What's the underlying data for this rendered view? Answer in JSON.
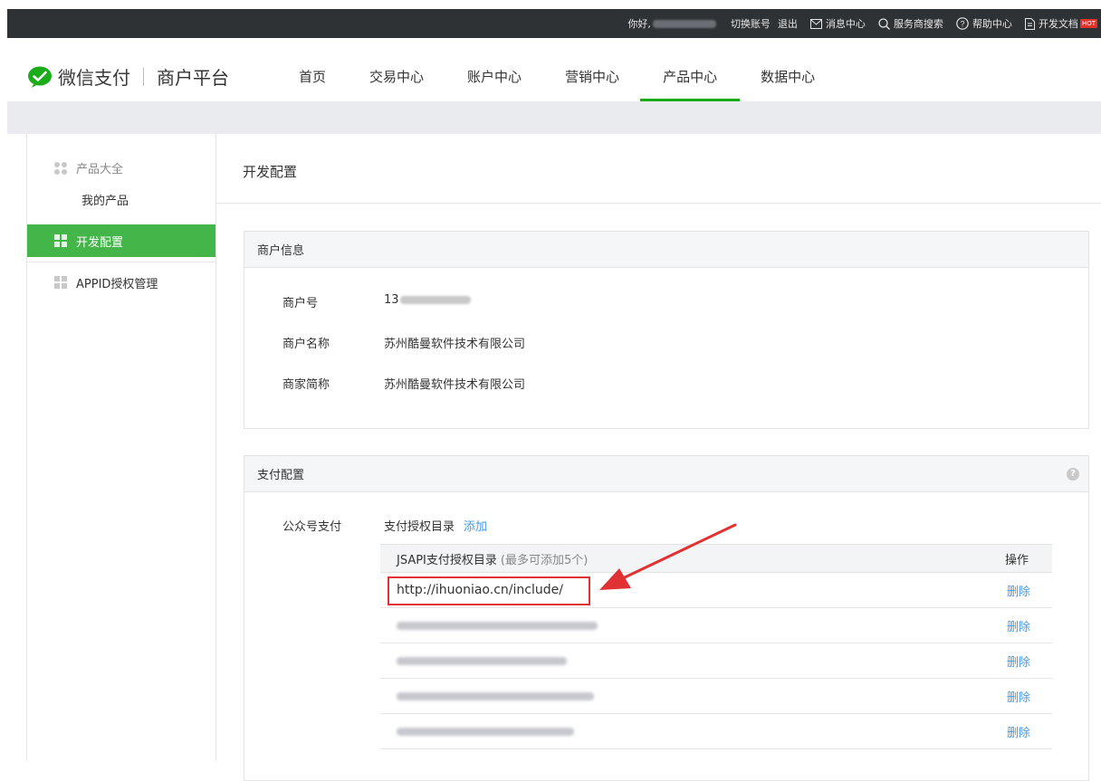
{
  "topbar": {
    "greeting": "你好,",
    "switch_account": "切换账号",
    "logout": "退出",
    "message_center": "消息中心",
    "provider_search": "服务商搜索",
    "help_center": "帮助中心",
    "dev_docs": "开发文档",
    "hot_badge": "HOT"
  },
  "header": {
    "brand": "微信支付",
    "platform": "商户平台",
    "menu": [
      "首页",
      "交易中心",
      "账户中心",
      "营销中心",
      "产品中心",
      "数据中心"
    ],
    "active_index": 4,
    "accent_color": "#1aad19"
  },
  "sidebar": {
    "group_label": "产品大全",
    "sub_item": "我的产品",
    "items": [
      {
        "label": "开发配置",
        "active": true
      },
      {
        "label": "APPID授权管理",
        "active": false
      }
    ]
  },
  "main": {
    "title": "开发配置",
    "merchant_panel": {
      "title": "商户信息",
      "rows": [
        {
          "label": "商户号",
          "value": "13"
        },
        {
          "label": "商户名称",
          "value": "苏州酷曼软件技术有限公司"
        },
        {
          "label": "商家简称",
          "value": "苏州酷曼软件技术有限公司"
        }
      ]
    },
    "payment_panel": {
      "title": "支付配置",
      "help_icon": "?",
      "jsapi_label": "公众号支付",
      "auth_dir_title": "支付授权目录",
      "add_link": "添加",
      "table_header": "JSAPI支付授权目录",
      "table_note": "(最多可添加5个)",
      "op_header": "操作",
      "rows": [
        {
          "url": "http://ihuoniao.cn/include/",
          "delete": "删除"
        },
        {
          "url": "",
          "delete": "删除"
        },
        {
          "url": "",
          "delete": "删除"
        },
        {
          "url": "",
          "delete": "删除"
        },
        {
          "url": "",
          "delete": "删除"
        }
      ]
    }
  },
  "annotation": {
    "highlight_color": "#e03232"
  }
}
